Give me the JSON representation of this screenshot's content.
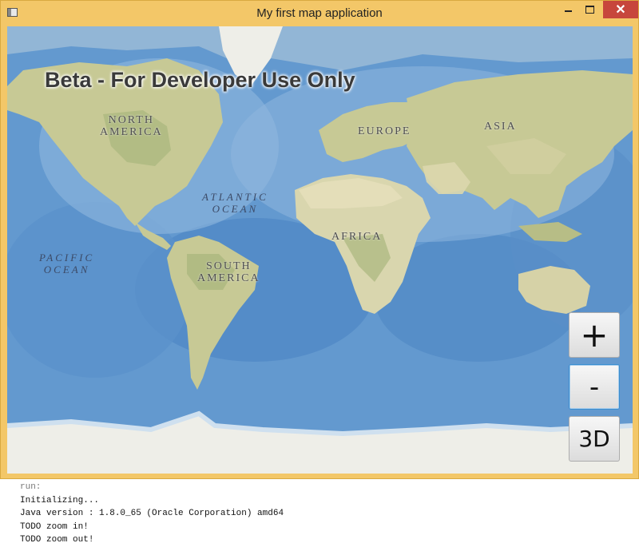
{
  "window": {
    "title": "My first map application",
    "close_glyph": "✕"
  },
  "map": {
    "banner": "Beta - For Developer Use Only",
    "labels": {
      "north_america": "NORTH\nAMERICA",
      "south_america": "SOUTH\nAMERICA",
      "europe": "EUROPE",
      "asia": "ASIA",
      "africa": "AFRICA",
      "atlantic_ocean": "ATLANTIC\nOCEAN",
      "pacific_ocean": "PACIFIC\nOCEAN"
    }
  },
  "controls": {
    "zoom_in": "+",
    "zoom_out": "-",
    "toggle_3d": "3D"
  },
  "console": {
    "lines": [
      "run:",
      "Initializing...",
      "Java version : 1.8.0_65 (Oracle Corporation) amd64",
      "TODO zoom in!",
      "TODO zoom out!"
    ]
  },
  "colors": {
    "window_frame": "#f3c768",
    "close_button": "#c7463c",
    "ocean": "#5f95cc",
    "land": "#c9cc9a",
    "ice": "#eeeee8"
  }
}
